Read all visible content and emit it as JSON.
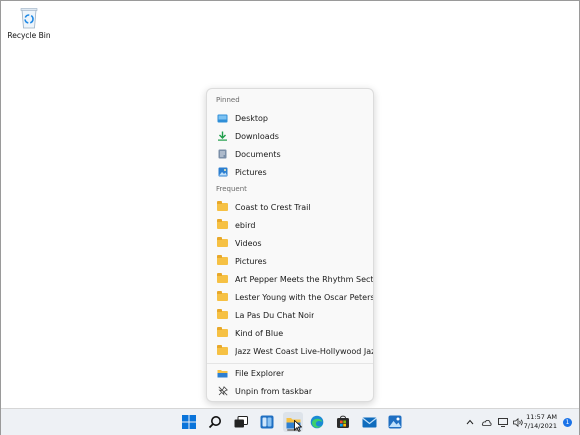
{
  "desktop": {
    "recycle_bin_label": "Recycle Bin"
  },
  "jumplist": {
    "pinned_header": "Pinned",
    "pinned": [
      {
        "label": "Desktop",
        "icon": "desktop-icon"
      },
      {
        "label": "Downloads",
        "icon": "download-arrow-icon"
      },
      {
        "label": "Documents",
        "icon": "documents-icon"
      },
      {
        "label": "Pictures",
        "icon": "pictures-icon"
      }
    ],
    "frequent_header": "Frequent",
    "frequent": [
      {
        "label": "Coast to Crest Trail"
      },
      {
        "label": "ebird"
      },
      {
        "label": "Videos"
      },
      {
        "label": "Pictures"
      },
      {
        "label": "Art Pepper Meets the Rhythm Section"
      },
      {
        "label": "Lester Young with the Oscar Petersо"
      },
      {
        "label": "La Pas Du Chat Noir"
      },
      {
        "label": "Kind of Blue"
      },
      {
        "label": "Jazz West Coast Live-Hollywood Jaz..."
      }
    ],
    "actions": [
      {
        "label": "File Explorer",
        "icon": "file-explorer-icon"
      },
      {
        "label": "Unpin from taskbar",
        "icon": "unpin-icon"
      }
    ]
  },
  "taskbar": {
    "time": "11:57 AM",
    "date": "7/14/2021",
    "notification_count": "1",
    "colors": {
      "accent": "#0078d4",
      "folder": "#f6c144"
    }
  }
}
